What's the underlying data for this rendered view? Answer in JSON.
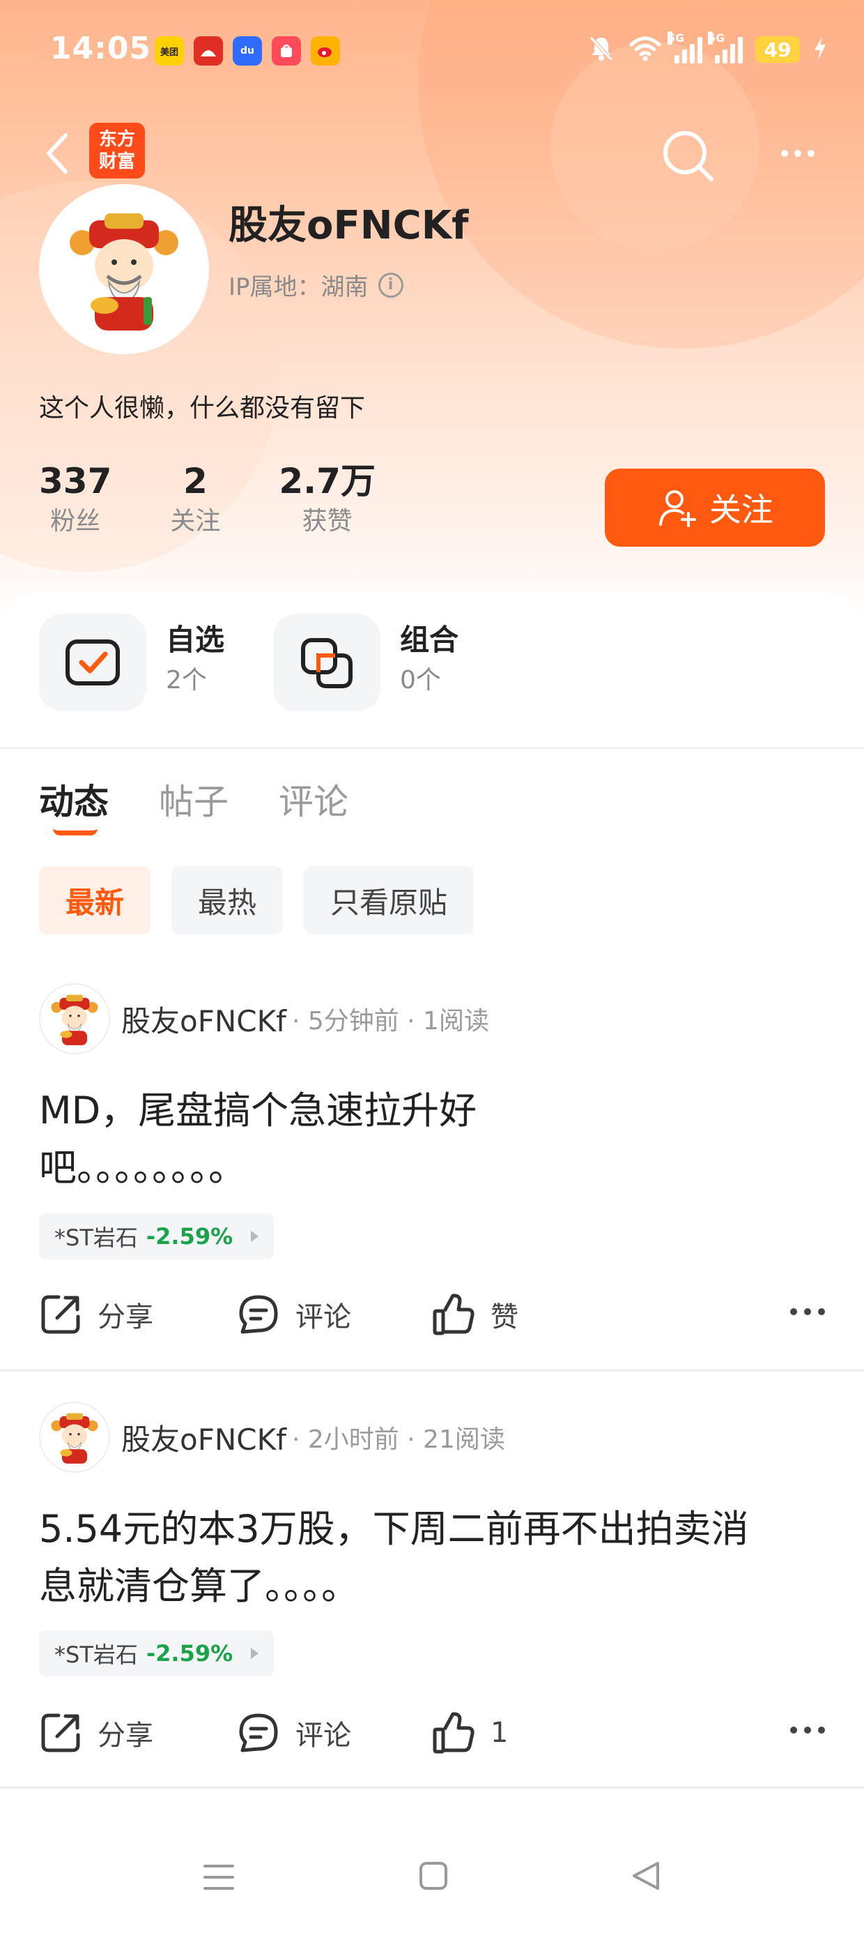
{
  "status_bar": {
    "time": "14:05",
    "battery": "49",
    "net1": "5G",
    "net2": "5G",
    "apps": [
      {
        "name": "meituan-app-icon",
        "label": "美团",
        "color": "#ffd100"
      },
      {
        "name": "pinduoduo-app-icon",
        "label": "",
        "color": "#e02e24"
      },
      {
        "name": "baidu-app-icon",
        "label": "du",
        "color": "#2f6bff"
      },
      {
        "name": "shopping-app-icon",
        "label": "",
        "color": "#ff4a5a"
      },
      {
        "name": "weibo-app-icon",
        "label": "",
        "color": "#ffb300"
      }
    ]
  },
  "nav": {
    "brand_line1": "东方",
    "brand_line2": "财富"
  },
  "profile": {
    "username": "股友oFNCKf",
    "ip_location": "IP属地：湖南",
    "bio": "这个人很懒，什么都没有留下",
    "stats": [
      {
        "value": "337",
        "label": "粉丝"
      },
      {
        "value": "2",
        "label": "关注"
      },
      {
        "value": "2.7万",
        "label": "获赞"
      }
    ],
    "follow_label": "关注"
  },
  "quick": {
    "watchlist_title": "自选",
    "watchlist_count": "2个",
    "portfolio_title": "组合",
    "portfolio_count": "0个"
  },
  "tabs": [
    "动态",
    "帖子",
    "评论"
  ],
  "filters": [
    "最新",
    "最热",
    "只看原贴"
  ],
  "actions": {
    "share": "分享",
    "comment": "评论",
    "like": "赞"
  },
  "posts": [
    {
      "author": "股友oFNCKf",
      "meta": "· 5分钟前 · 1阅读",
      "line1": "MD，尾盘搞个急速拉升好",
      "line2": "吧。。。。。。。。",
      "stock": "*ST岩石",
      "change": "-2.59%",
      "likes": "赞"
    },
    {
      "author": "股友oFNCKf",
      "meta": "· 2小时前 · 21阅读",
      "line1": "5.54元的本3万股，下周二前再不出拍卖消",
      "line2": "息就清仓算了。。。。",
      "stock": "*ST岩石",
      "change": "-2.59%",
      "likes": "1"
    }
  ],
  "colors": {
    "accent": "#ff5a10",
    "down": "#1aa34a"
  }
}
